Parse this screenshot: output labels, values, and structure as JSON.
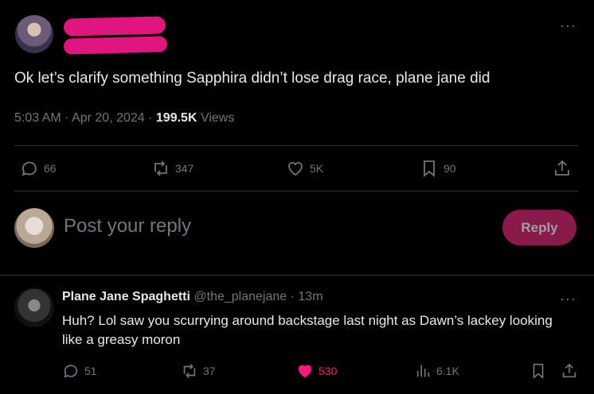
{
  "tweet": {
    "text": "Ok let’s clarify something Sapphira didn’t lose drag race, plane jane did",
    "time": "5:03 AM",
    "date": "Apr 20, 2024",
    "views_count": "199.5K",
    "views_label": "Views",
    "more": "···",
    "stats": {
      "replies": "66",
      "retweets": "347",
      "likes": "5K",
      "bookmarks": "90"
    }
  },
  "composer": {
    "placeholder": "Post your reply",
    "button": "Reply"
  },
  "reply": {
    "name": "Plane Jane Spaghetti",
    "handle": "@the_planejane",
    "time": "13m",
    "more": "···",
    "text": "Huh? Lol saw you scurrying around backstage last night as Dawn’s lackey looking like a greasy moron",
    "stats": {
      "replies": "51",
      "retweets": "37",
      "likes": "530",
      "views": "6.1K"
    }
  },
  "colors": {
    "background": "#000000",
    "text": "#e7e9ea",
    "muted": "#71767b",
    "like_active": "#f91880",
    "reply_button": "#8b1a4c",
    "redaction": "#e0157f"
  }
}
